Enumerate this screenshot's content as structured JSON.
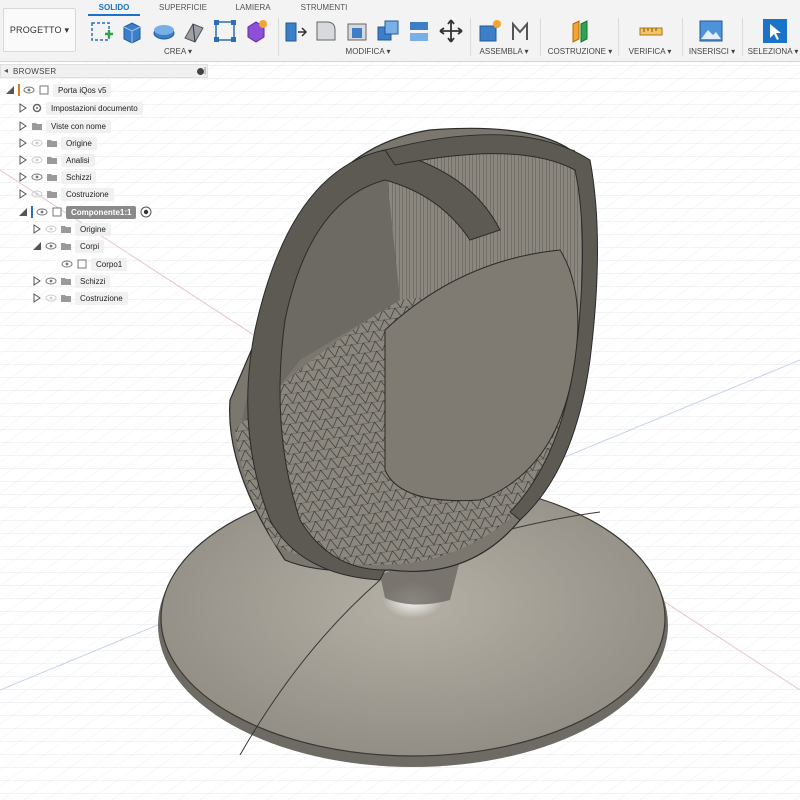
{
  "toolbar": {
    "project_label": "PROGETTO ▾",
    "tabs": [
      "SOLIDO",
      "SUPERFICIE",
      "LAMIERA",
      "STRUMENTI"
    ],
    "active_tab": "SOLIDO",
    "groups": [
      "CREA ▾",
      "MODIFICA ▾",
      "ASSEMBLA ▾",
      "COSTRUZIONE ▾",
      "VERIFICA ▾",
      "INSERISCI ▾",
      "SELEZIONA ▾"
    ],
    "accent_color": "#1a73c8"
  },
  "browser": {
    "title": "BROWSER",
    "items": [
      {
        "label": "Porta iQos v5",
        "icon": "document-icon"
      },
      {
        "label": "Impostazioni documento",
        "icon": "gear-icon"
      },
      {
        "label": "Viste con nome",
        "icon": "folder-icon"
      },
      {
        "label": "Origine",
        "icon": "folder-icon"
      },
      {
        "label": "Analisi",
        "icon": "folder-icon"
      },
      {
        "label": "Schizzi",
        "icon": "folder-icon"
      },
      {
        "label": "Costruzione",
        "icon": "folder-icon"
      },
      {
        "label": "Componente1:1",
        "icon": "component-icon"
      },
      {
        "label": "Origine",
        "icon": "folder-icon"
      },
      {
        "label": "Corpi",
        "icon": "folder-icon"
      },
      {
        "label": "Corpo1",
        "icon": "body-icon"
      },
      {
        "label": "Schizzi",
        "icon": "folder-icon"
      },
      {
        "label": "Costruzione",
        "icon": "folder-icon"
      }
    ]
  },
  "model": {
    "body_color": "#7b776f",
    "base_color": "#a29e94",
    "edge_color": "#2b2b2b"
  }
}
